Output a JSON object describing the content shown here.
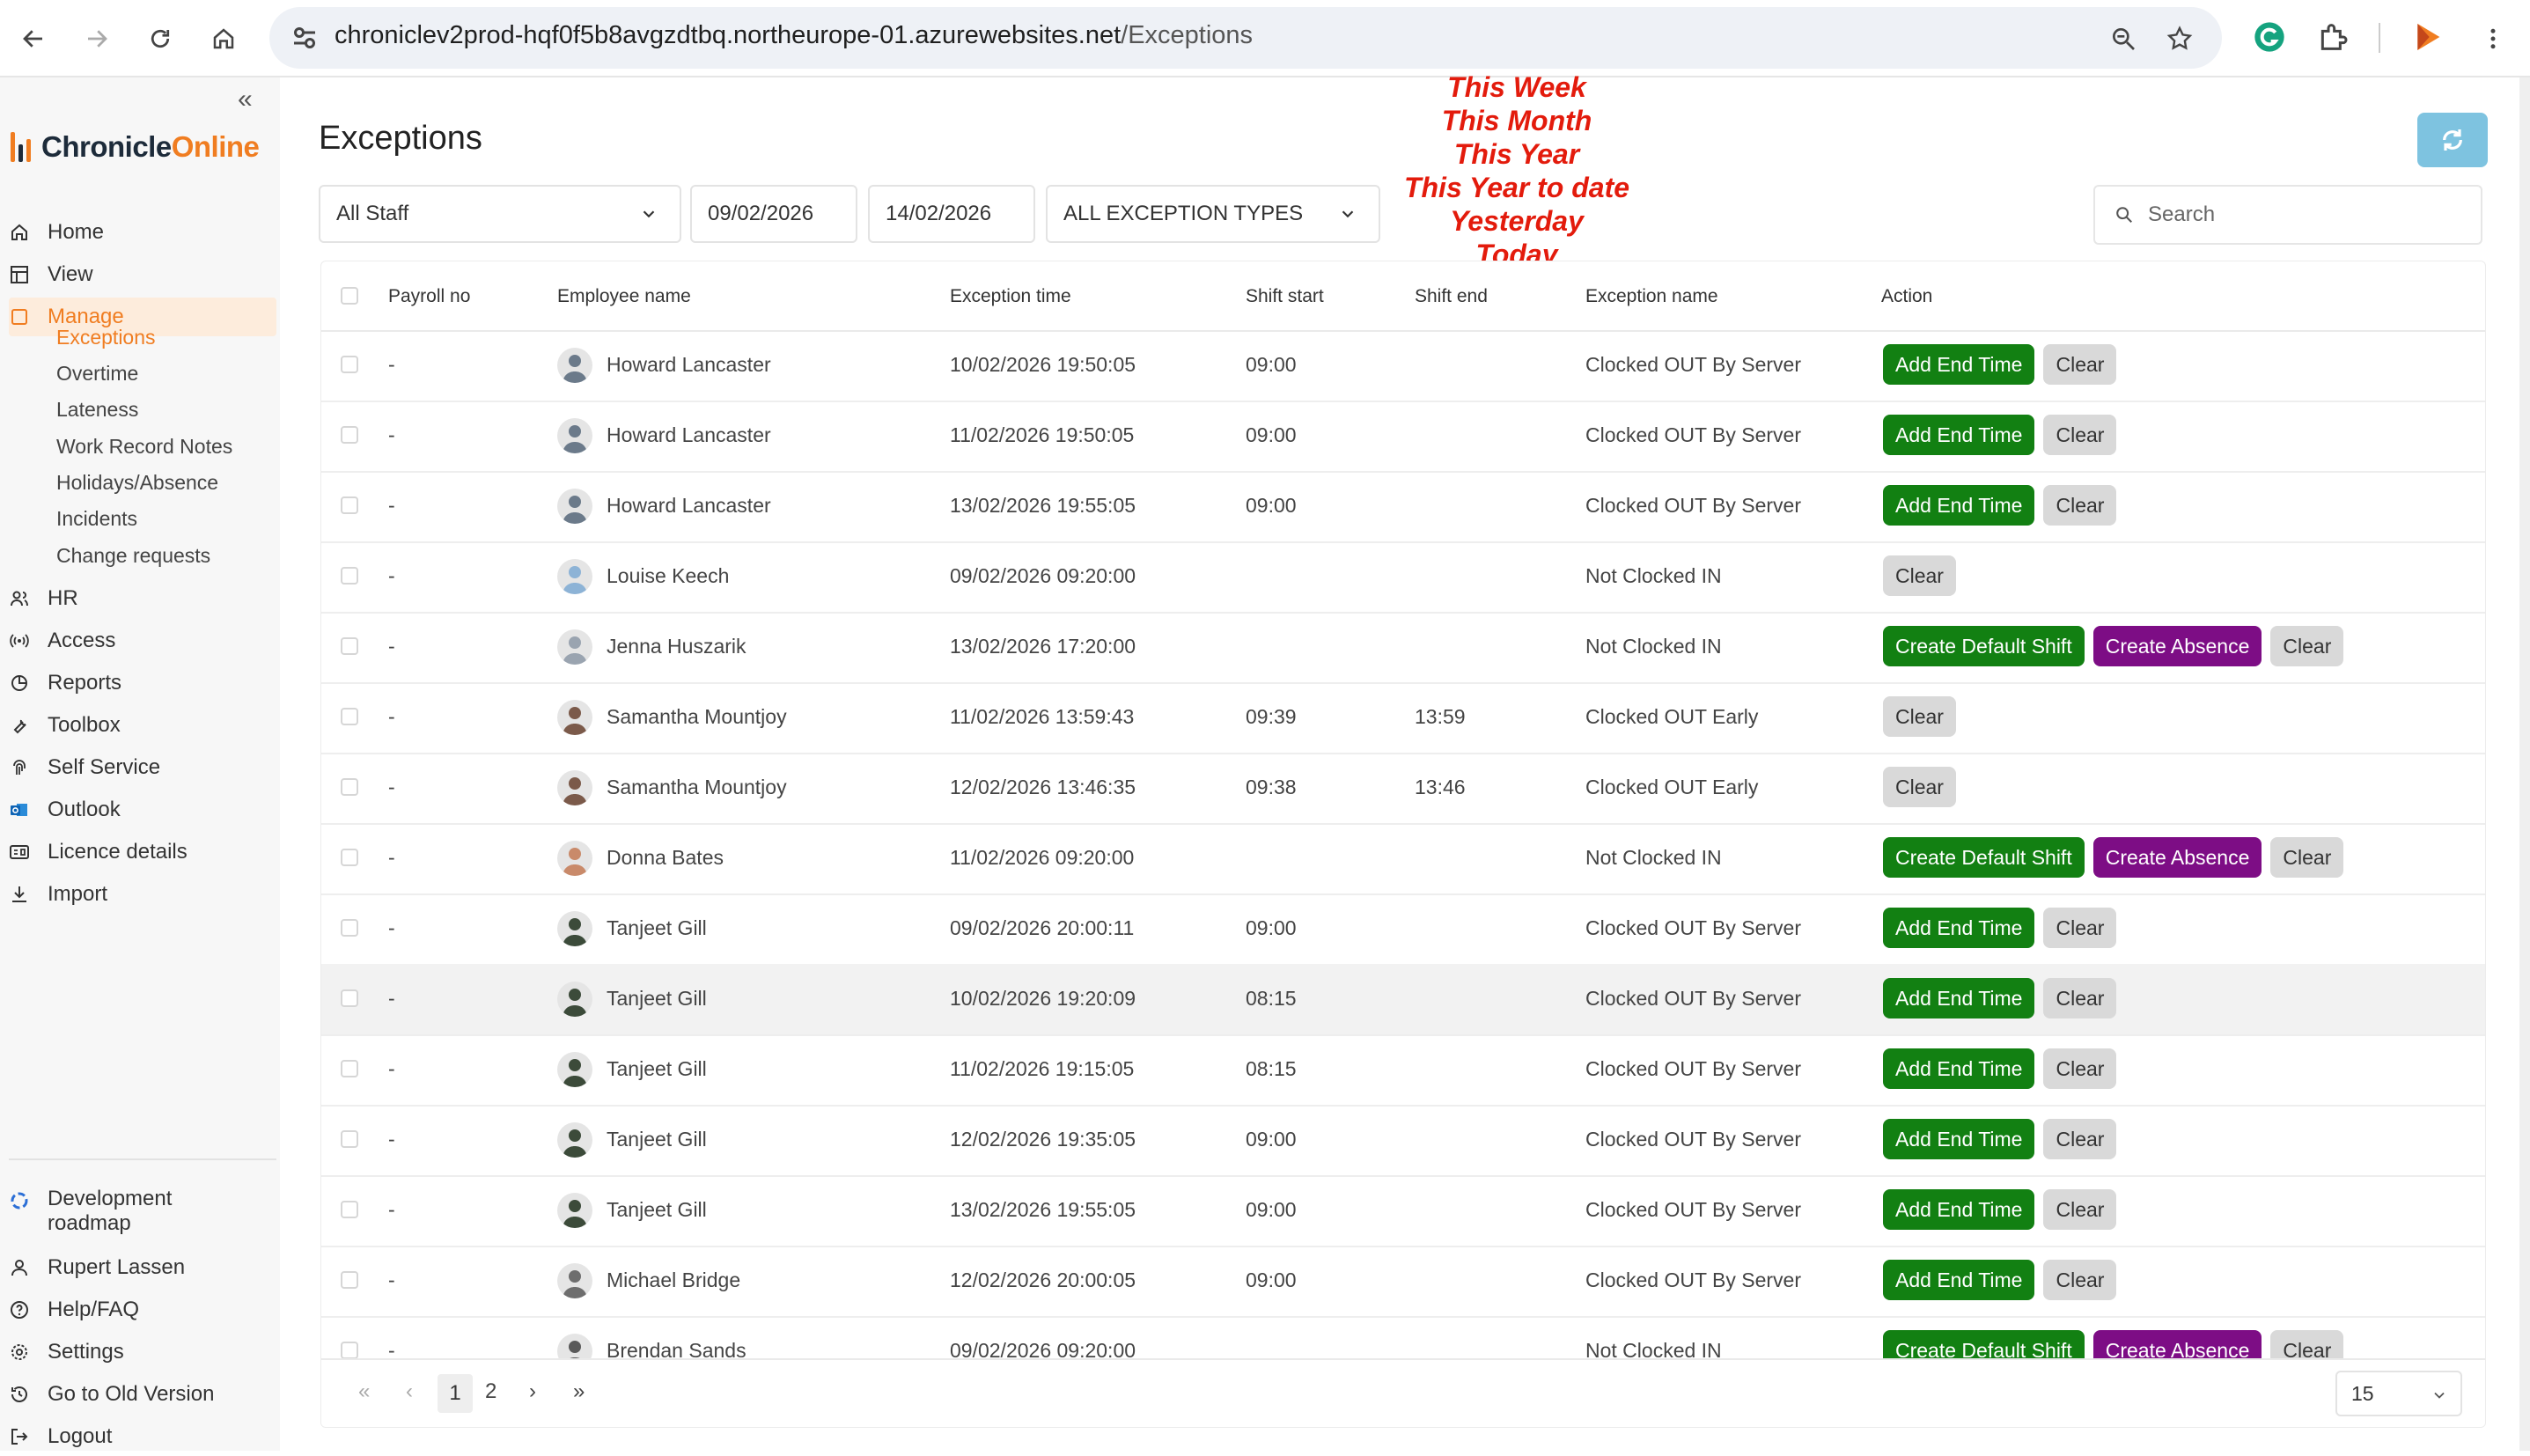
{
  "browser": {
    "url_domain": "chroniclev2prod-hqf0f5b8avgzdtbq.northeurope-01.azurewebsites.net",
    "url_path": "/Exceptions"
  },
  "sidebar": {
    "logo_part1": "Chronicle",
    "logo_part2": "Online",
    "nav": [
      {
        "label": "Home",
        "icon": "home-icon"
      },
      {
        "label": "View",
        "icon": "grid-icon"
      },
      {
        "label": "Manage",
        "icon": "square-icon"
      },
      {
        "label": "HR",
        "icon": "people-icon"
      },
      {
        "label": "Access",
        "icon": "signal-icon"
      },
      {
        "label": "Reports",
        "icon": "reports-icon"
      },
      {
        "label": "Toolbox",
        "icon": "wrench-icon"
      },
      {
        "label": "Self Service",
        "icon": "fingerprint-icon"
      },
      {
        "label": "Outlook",
        "icon": "outlook-icon"
      },
      {
        "label": "Licence details",
        "icon": "licence-icon"
      },
      {
        "label": "Import",
        "icon": "download-icon"
      }
    ],
    "manage_sub": [
      "Exceptions",
      "Overtime",
      "Lateness",
      "Work Record Notes",
      "Holidays/Absence",
      "Incidents",
      "Change requests"
    ],
    "bottom": [
      {
        "label": "Development\nroadmap",
        "icon": "roadmap-icon"
      },
      {
        "label": "Rupert Lassen",
        "icon": "user-icon"
      },
      {
        "label": "Help/FAQ",
        "icon": "help-icon"
      },
      {
        "label": "Settings",
        "icon": "gear-icon"
      },
      {
        "label": "Go to Old Version",
        "icon": "history-icon"
      },
      {
        "label": "Logout",
        "icon": "logout-icon"
      }
    ]
  },
  "page": {
    "title": "Exceptions",
    "staff_filter": "All Staff",
    "date_from": "09/02/2026",
    "date_to": "14/02/2026",
    "exception_type": "ALL EXCEPTION TYPES",
    "search_placeholder": "Search"
  },
  "quick_dates": [
    "This Week",
    "This Month",
    "This Year",
    "This Year to date",
    "Yesterday",
    "Today"
  ],
  "table": {
    "headers": {
      "payroll": "Payroll no",
      "employee": "Employee name",
      "exception_time": "Exception time",
      "shift_start": "Shift start",
      "shift_end": "Shift end",
      "exception_name": "Exception name",
      "action": "Action"
    },
    "rows": [
      {
        "payroll": "-",
        "name": "Howard Lancaster",
        "time": "10/02/2026 19:50:05",
        "start": "09:00",
        "end": "",
        "exception": "Clocked OUT By Server",
        "actions": [
          "Add End Time",
          "Clear"
        ],
        "avatar": "#6b7a8a"
      },
      {
        "payroll": "-",
        "name": "Howard Lancaster",
        "time": "11/02/2026 19:50:05",
        "start": "09:00",
        "end": "",
        "exception": "Clocked OUT By Server",
        "actions": [
          "Add End Time",
          "Clear"
        ],
        "avatar": "#6b7a8a"
      },
      {
        "payroll": "-",
        "name": "Howard Lancaster",
        "time": "13/02/2026 19:55:05",
        "start": "09:00",
        "end": "",
        "exception": "Clocked OUT By Server",
        "actions": [
          "Add End Time",
          "Clear"
        ],
        "avatar": "#6b7a8a"
      },
      {
        "payroll": "-",
        "name": "Louise Keech",
        "time": "09/02/2026 09:20:00",
        "start": "",
        "end": "",
        "exception": "Not Clocked IN",
        "actions": [
          "Clear"
        ],
        "avatar": "#8db3d6"
      },
      {
        "payroll": "-",
        "name": "Jenna Huszarik",
        "time": "13/02/2026 17:20:00",
        "start": "",
        "end": "",
        "exception": "Not Clocked IN",
        "actions": [
          "Create Default Shift",
          "Create Absence",
          "Clear"
        ],
        "avatar": "#9aa4b0"
      },
      {
        "payroll": "-",
        "name": "Samantha Mountjoy",
        "time": "11/02/2026 13:59:43",
        "start": "09:39",
        "end": "13:59",
        "exception": "Clocked OUT Early",
        "actions": [
          "Clear"
        ],
        "avatar": "#7b5a4a"
      },
      {
        "payroll": "-",
        "name": "Samantha Mountjoy",
        "time": "12/02/2026 13:46:35",
        "start": "09:38",
        "end": "13:46",
        "exception": "Clocked OUT Early",
        "actions": [
          "Clear"
        ],
        "avatar": "#7b5a4a"
      },
      {
        "payroll": "-",
        "name": "Donna Bates",
        "time": "11/02/2026 09:20:00",
        "start": "",
        "end": "",
        "exception": "Not Clocked IN",
        "actions": [
          "Create Default Shift",
          "Create Absence",
          "Clear"
        ],
        "avatar": "#c98a6a"
      },
      {
        "payroll": "-",
        "name": "Tanjeet Gill",
        "time": "09/02/2026 20:00:11",
        "start": "09:00",
        "end": "",
        "exception": "Clocked OUT By Server",
        "actions": [
          "Add End Time",
          "Clear"
        ],
        "avatar": "#3c4b3a"
      },
      {
        "payroll": "-",
        "name": "Tanjeet Gill",
        "time": "10/02/2026 19:20:09",
        "start": "08:15",
        "end": "",
        "exception": "Clocked OUT By Server",
        "actions": [
          "Add End Time",
          "Clear"
        ],
        "avatar": "#3c4b3a",
        "hover": true
      },
      {
        "payroll": "-",
        "name": "Tanjeet Gill",
        "time": "11/02/2026 19:15:05",
        "start": "08:15",
        "end": "",
        "exception": "Clocked OUT By Server",
        "actions": [
          "Add End Time",
          "Clear"
        ],
        "avatar": "#3c4b3a"
      },
      {
        "payroll": "-",
        "name": "Tanjeet Gill",
        "time": "12/02/2026 19:35:05",
        "start": "09:00",
        "end": "",
        "exception": "Clocked OUT By Server",
        "actions": [
          "Add End Time",
          "Clear"
        ],
        "avatar": "#3c4b3a"
      },
      {
        "payroll": "-",
        "name": "Tanjeet Gill",
        "time": "13/02/2026 19:55:05",
        "start": "09:00",
        "end": "",
        "exception": "Clocked OUT By Server",
        "actions": [
          "Add End Time",
          "Clear"
        ],
        "avatar": "#3c4b3a"
      },
      {
        "payroll": "-",
        "name": "Michael Bridge",
        "time": "12/02/2026 20:00:05",
        "start": "09:00",
        "end": "",
        "exception": "Clocked OUT By Server",
        "actions": [
          "Add End Time",
          "Clear"
        ],
        "avatar": "#6e6e6e"
      },
      {
        "payroll": "-",
        "name": "Brendan Sands",
        "time": "09/02/2026 09:20:00",
        "start": "",
        "end": "",
        "exception": "Not Clocked IN",
        "actions": [
          "Create Default Shift",
          "Create Absence",
          "Clear"
        ],
        "avatar": "#5a5a5a"
      }
    ]
  },
  "pagination": {
    "first": "«",
    "prev": "‹",
    "pages": [
      "1",
      "2"
    ],
    "next": "›",
    "last": "»",
    "page_size": "15"
  },
  "colors": {
    "brand_orange": "#f07d21",
    "add_end_time": "#128012",
    "create_absence": "#7d0d85",
    "clear": "#d9d9d9",
    "quick_dates": "#e31b0c",
    "refresh": "#7ec3e0"
  }
}
